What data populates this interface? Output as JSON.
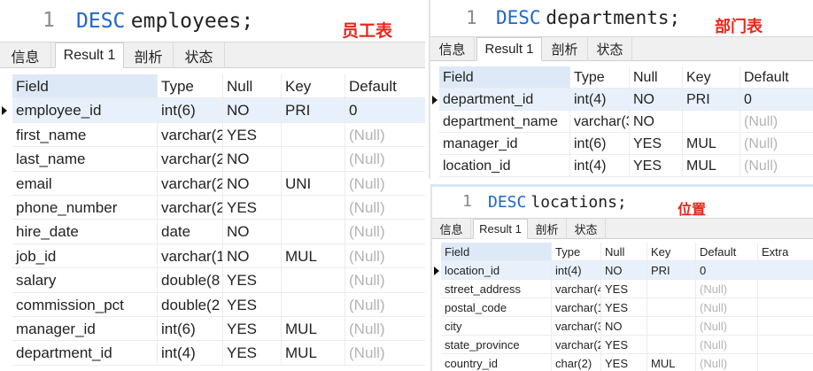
{
  "tabs": [
    "信息",
    "Result 1",
    "剖析",
    "状态"
  ],
  "employees": {
    "line_number": "1",
    "sql_keyword": "DESC",
    "sql_rest": "employees;",
    "caption": "员工表",
    "columns": [
      "Field",
      "Type",
      "Null",
      "Key",
      "Default"
    ],
    "rows": [
      [
        "employee_id",
        "int(6)",
        "NO",
        "PRI",
        "0"
      ],
      [
        "first_name",
        "varchar(2",
        "YES",
        "",
        "(Null)"
      ],
      [
        "last_name",
        "varchar(2",
        "NO",
        "",
        "(Null)"
      ],
      [
        "email",
        "varchar(2",
        "NO",
        "UNI",
        "(Null)"
      ],
      [
        "phone_number",
        "varchar(2",
        "YES",
        "",
        "(Null)"
      ],
      [
        "hire_date",
        "date",
        "NO",
        "",
        "(Null)"
      ],
      [
        "job_id",
        "varchar(1",
        "NO",
        "MUL",
        "(Null)"
      ],
      [
        "salary",
        "double(8",
        "YES",
        "",
        "(Null)"
      ],
      [
        "commission_pct",
        "double(2",
        "YES",
        "",
        "(Null)"
      ],
      [
        "manager_id",
        "int(6)",
        "YES",
        "MUL",
        "(Null)"
      ],
      [
        "department_id",
        "int(4)",
        "YES",
        "MUL",
        "(Null)"
      ]
    ]
  },
  "departments": {
    "line_number": "1",
    "sql_keyword": "DESC",
    "sql_rest": "departments;",
    "caption": "部门表",
    "columns": [
      "Field",
      "Type",
      "Null",
      "Key",
      "Default"
    ],
    "rows": [
      [
        "department_id",
        "int(4)",
        "NO",
        "PRI",
        "0"
      ],
      [
        "department_name",
        "varchar(3",
        "NO",
        "",
        "(Null)"
      ],
      [
        "manager_id",
        "int(6)",
        "YES",
        "MUL",
        "(Null)"
      ],
      [
        "location_id",
        "int(4)",
        "YES",
        "MUL",
        "(Null)"
      ]
    ]
  },
  "locations": {
    "line_number": "1",
    "sql_keyword": "DESC",
    "sql_rest": "locations;",
    "caption": "位置",
    "columns": [
      "Field",
      "Type",
      "Null",
      "Key",
      "Default",
      "Extra"
    ],
    "rows": [
      [
        "location_id",
        "int(4)",
        "NO",
        "PRI",
        "0",
        ""
      ],
      [
        "street_address",
        "varchar(4",
        "YES",
        "",
        "(Null)",
        ""
      ],
      [
        "postal_code",
        "varchar(1",
        "YES",
        "",
        "(Null)",
        ""
      ],
      [
        "city",
        "varchar(3",
        "NO",
        "",
        "(Null)",
        ""
      ],
      [
        "state_province",
        "varchar(2",
        "YES",
        "",
        "(Null)",
        ""
      ],
      [
        "country_id",
        "char(2)",
        "YES",
        "MUL",
        "(Null)",
        ""
      ]
    ]
  },
  "colors": {
    "keyword": "#1f66c9",
    "caption": "#e8261c",
    "null_text": "#b4b4b4",
    "header_field_bg": "#dde9f7"
  },
  "icons": {
    "current_row": "row-pointer-triangle"
  }
}
